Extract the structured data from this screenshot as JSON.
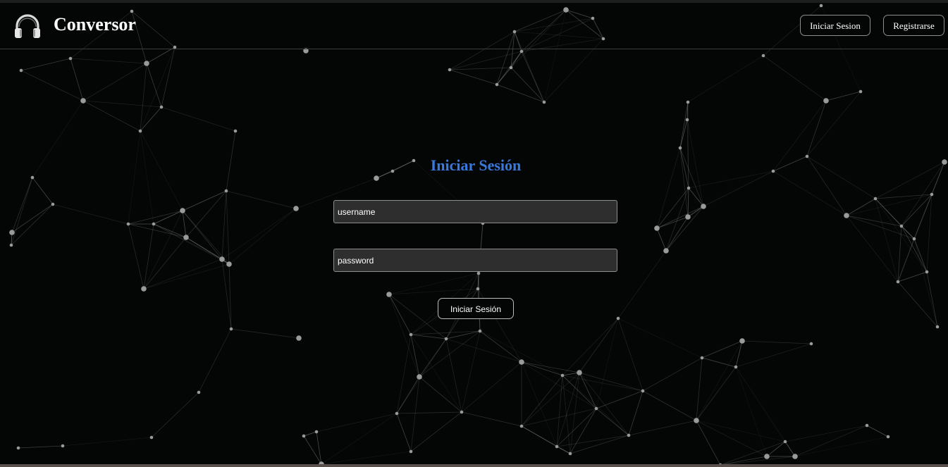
{
  "header": {
    "brand": "Conversor",
    "login_label": "Iniciar Sesion",
    "register_label": "Registrarse",
    "logo_icon": "headphones-icon"
  },
  "login": {
    "title": "Iniciar Sesión",
    "username_placeholder": "username",
    "password_placeholder": "password",
    "submit_label": "Iniciar Sesión"
  },
  "colors": {
    "background": "#030605",
    "title_accent": "#3978dc",
    "input_background": "#2e2e2e",
    "particle": "#9a9a9a"
  }
}
